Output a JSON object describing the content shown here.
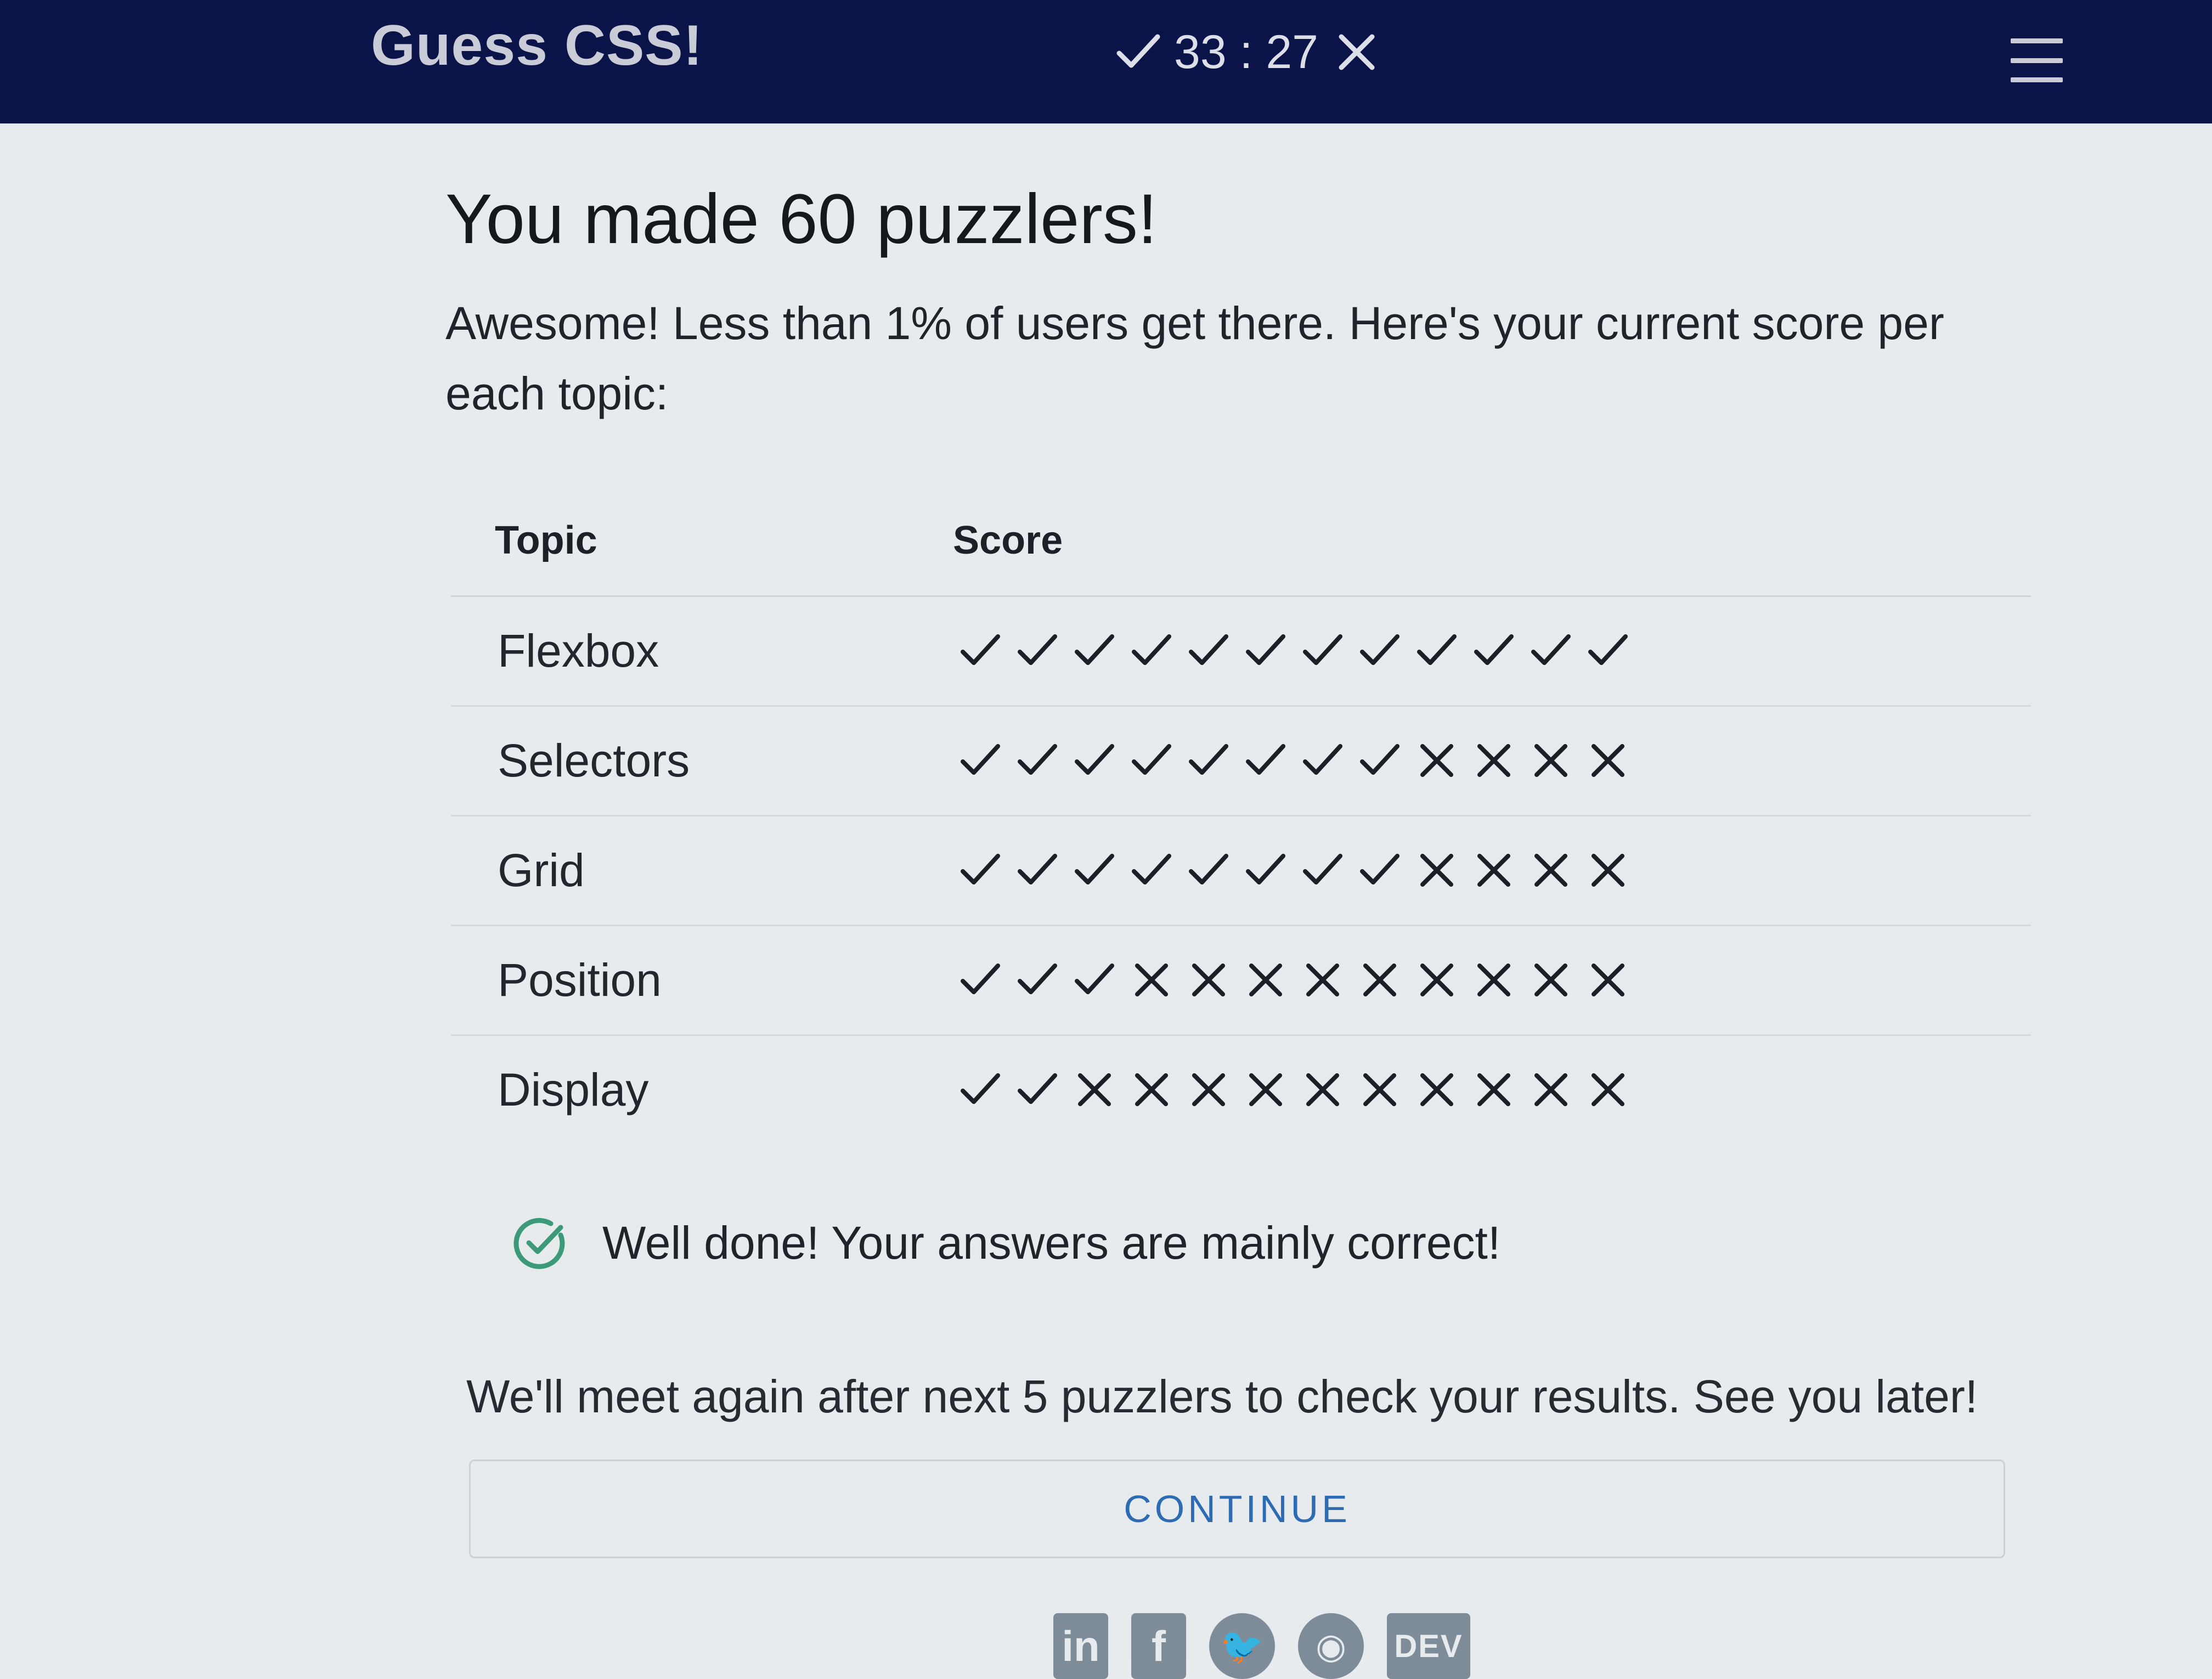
{
  "header": {
    "title": "Guess CSS!",
    "score_separator": "33 : 27",
    "correct_icon": "check-icon",
    "wrong_icon": "cross-icon",
    "menu_icon": "hamburger-menu-icon"
  },
  "main": {
    "headline": "You made 60 puzzlers!",
    "intro": "Awesome! Less than 1% of users get there. Here's your current score per each topic:",
    "table": {
      "col_topic": "Topic",
      "col_score": "Score",
      "rows": [
        {
          "topic": "Flexbox",
          "correct": 12,
          "total": 12
        },
        {
          "topic": "Selectors",
          "correct": 8,
          "total": 12
        },
        {
          "topic": "Grid",
          "correct": 8,
          "total": 12
        },
        {
          "topic": "Position",
          "correct": 3,
          "total": 12
        },
        {
          "topic": "Display",
          "correct": 2,
          "total": 12
        }
      ]
    },
    "feedback": "Well done! Your answers are mainly correct!",
    "outro": "We'll meet again after next 5 puzzlers to check your results. See you later!",
    "continue_label": "CONTINUE"
  },
  "footer": {
    "socials": [
      {
        "name": "linkedin-icon",
        "glyph": "in"
      },
      {
        "name": "facebook-icon",
        "glyph": "f"
      },
      {
        "name": "twitter-icon",
        "glyph": "🐦"
      },
      {
        "name": "github-icon",
        "glyph": "◉"
      },
      {
        "name": "dev-icon",
        "glyph": "DEV"
      }
    ]
  },
  "colors": {
    "topbar": "#0b1448",
    "accent": "#2d6cb3",
    "success": "#3d9a78"
  }
}
